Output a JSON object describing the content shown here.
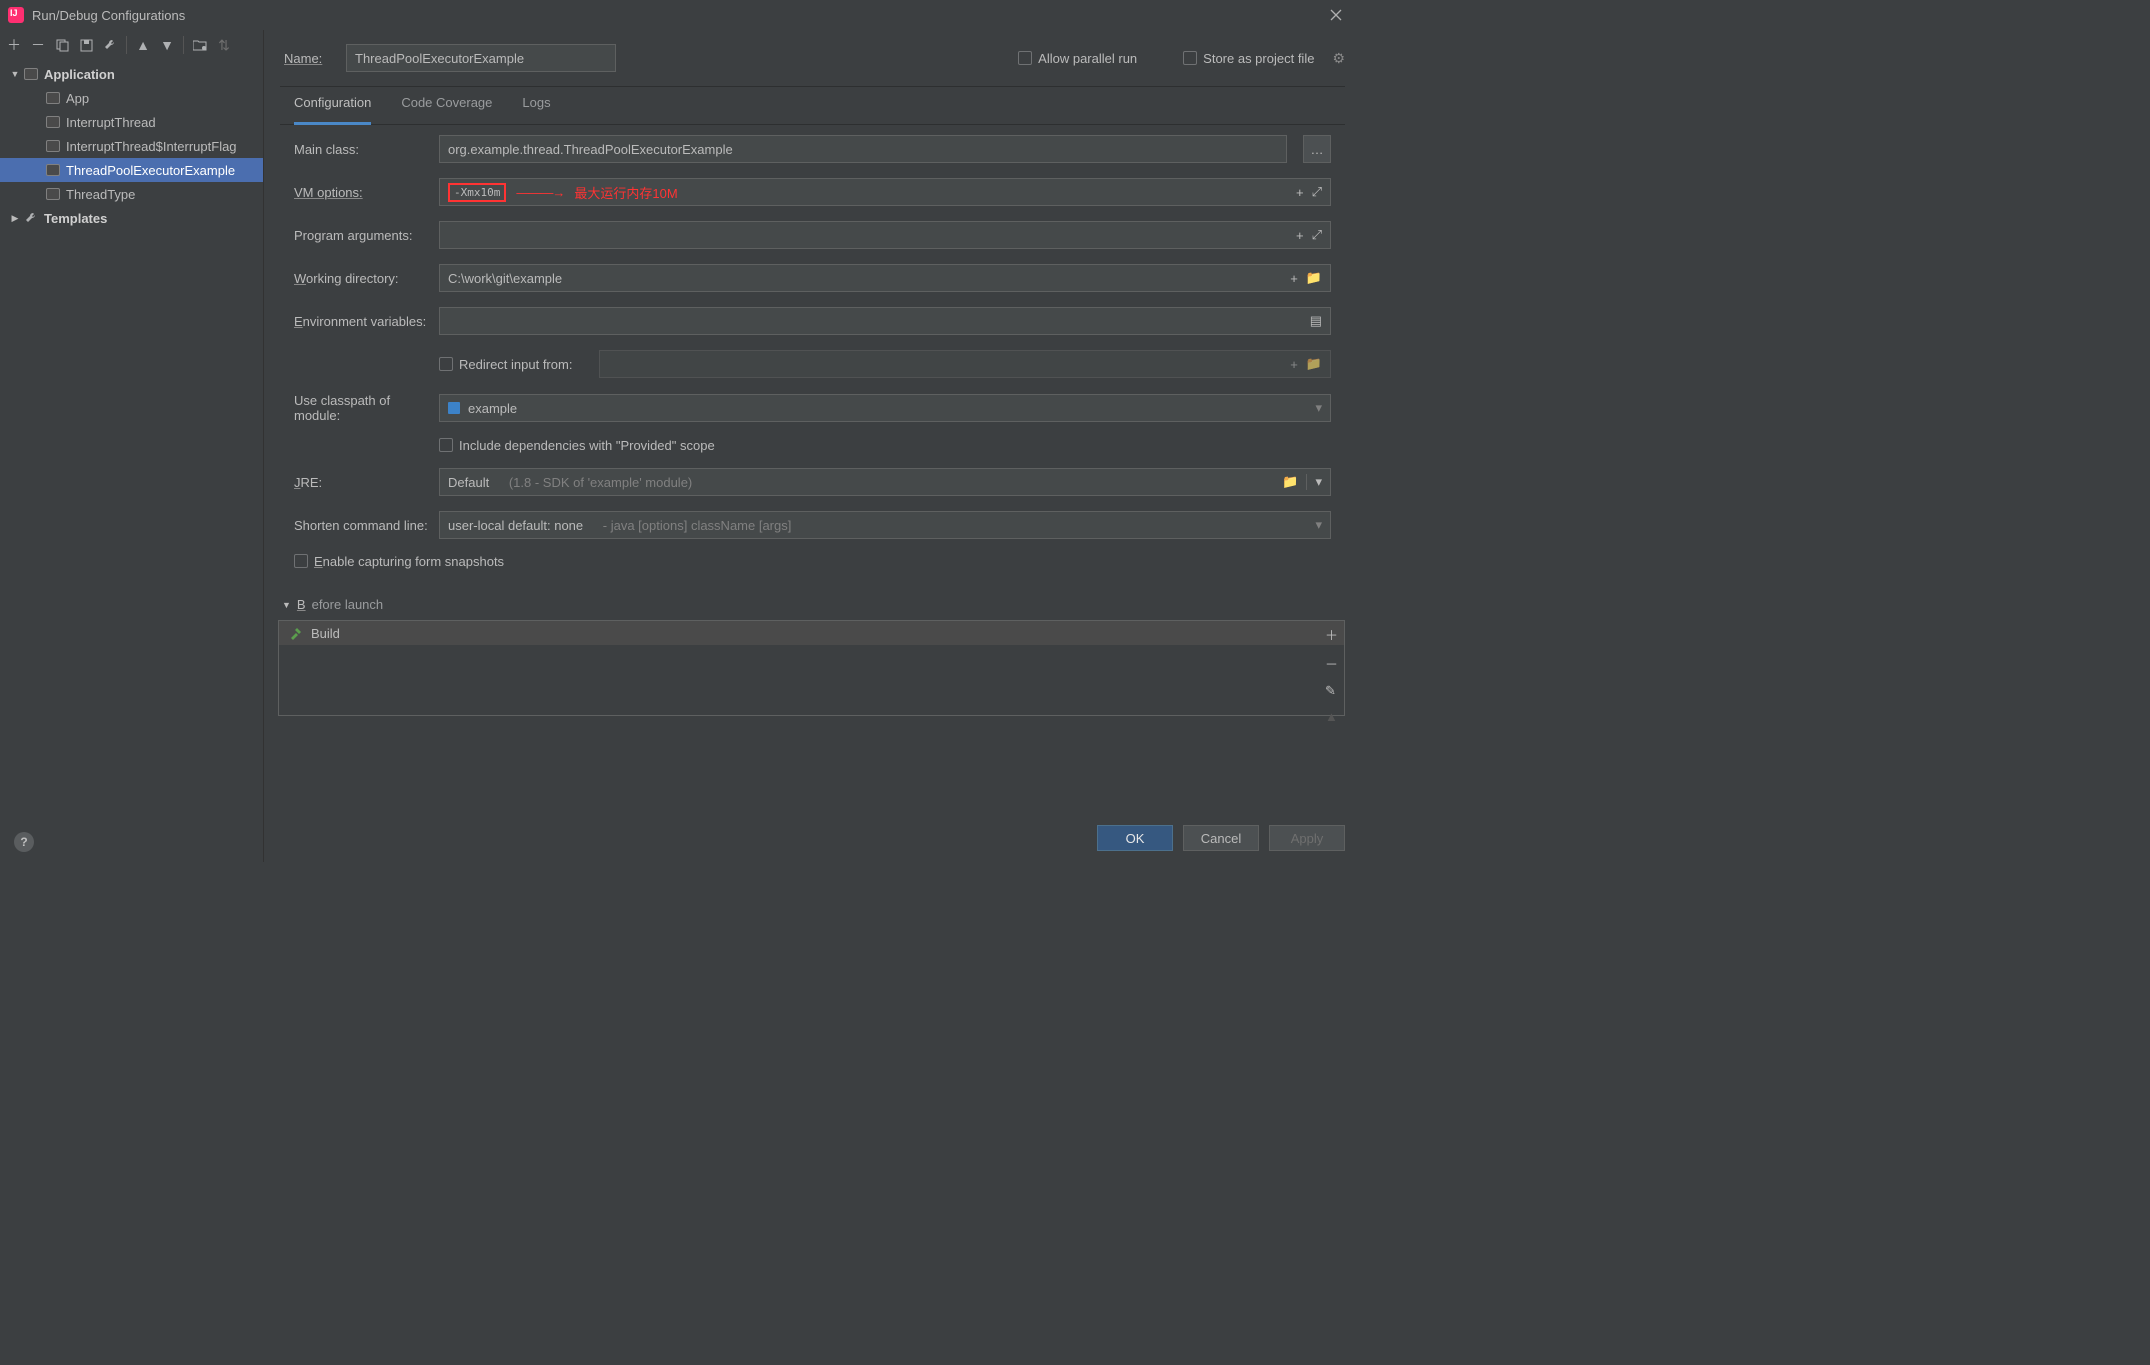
{
  "title": "Run/Debug Configurations",
  "sidebar": {
    "toolbar": [
      "add",
      "remove",
      "copy",
      "save",
      "wrench",
      "up",
      "down",
      "folder",
      "sort"
    ],
    "root": {
      "label": "Application"
    },
    "items": [
      {
        "label": "App"
      },
      {
        "label": "InterruptThread"
      },
      {
        "label": "InterruptThread$InterruptFlag"
      },
      {
        "label": "ThreadPoolExecutorExample"
      },
      {
        "label": "ThreadType"
      }
    ],
    "templates": "Templates"
  },
  "header": {
    "name_label": "Name:",
    "name_value": "ThreadPoolExecutorExample",
    "allow_parallel": "Allow parallel run",
    "store_as": "Store as project file"
  },
  "tabs": {
    "configuration": "Configuration",
    "coverage": "Code Coverage",
    "logs": "Logs"
  },
  "form": {
    "main_class_label": "Main class:",
    "main_class_value": "org.example.thread.ThreadPoolExecutorExample",
    "vm_options_label": "VM options:",
    "vm_options_value": "-Xmx10m",
    "vm_annotation_arrow": "———→",
    "vm_annotation_text": "最大运行内存10M",
    "program_args_label": "Program arguments:",
    "program_args_value": "",
    "working_dir_label": "Working directory:",
    "working_dir_value": "C:\\work\\git\\example",
    "env_label": "Environment variables:",
    "env_value": "",
    "redirect_label": "Redirect input from:",
    "classpath_label": "Use classpath of module:",
    "classpath_value": "example",
    "include_provided": "Include dependencies with \"Provided\" scope",
    "jre_label": "JRE:",
    "jre_value": "Default",
    "jre_hint": "(1.8 - SDK of 'example' module)",
    "shorten_label": "Shorten command line:",
    "shorten_value": "user-local default: none",
    "shorten_hint": "- java [options] className [args]",
    "enable_snapshots": "Enable capturing form snapshots"
  },
  "before_launch": {
    "label": "Before launch",
    "build": "Build"
  },
  "footer": {
    "ok": "OK",
    "cancel": "Cancel",
    "apply": "Apply"
  }
}
